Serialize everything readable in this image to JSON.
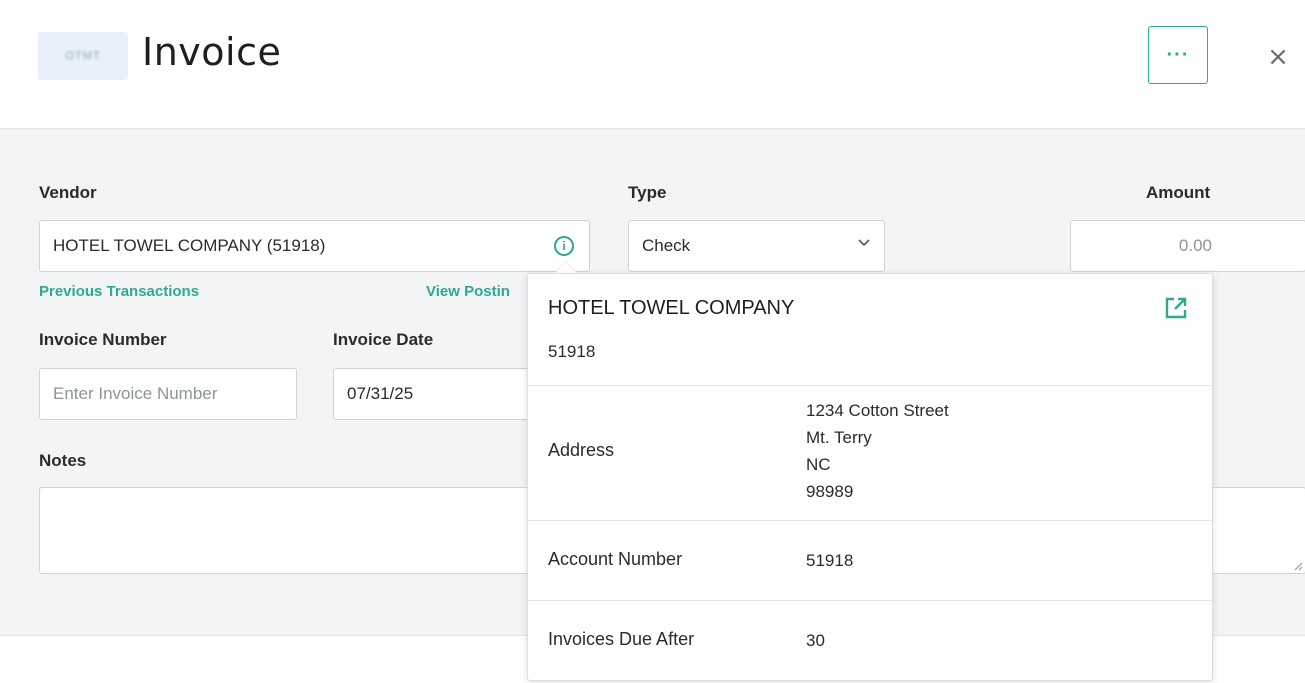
{
  "header": {
    "logo_text": "OTMT",
    "title": "Invoice",
    "more_label": "···",
    "close_label": "×"
  },
  "form": {
    "vendor": {
      "label": "Vendor",
      "value": "HOTEL TOWEL COMPANY (51918)",
      "previous_transactions": "Previous Transactions",
      "view_postings": "View Postin"
    },
    "type": {
      "label": "Type",
      "value": "Check"
    },
    "amount": {
      "label": "Amount",
      "placeholder": "0.00"
    },
    "invoice_number": {
      "label": "Invoice Number",
      "placeholder": "Enter Invoice Number"
    },
    "invoice_date": {
      "label": "Invoice Date",
      "value": "07/31/25"
    },
    "notes": {
      "label": "Notes",
      "value": ""
    }
  },
  "vendor_popover": {
    "name": "HOTEL TOWEL COMPANY",
    "id": "51918",
    "rows": [
      {
        "key": "Address",
        "value_lines": [
          "1234 Cotton Street",
          "Mt. Terry",
          "NC",
          "98989"
        ]
      },
      {
        "key": "Account Number",
        "value": "51918"
      },
      {
        "key": "Invoices Due After",
        "value": "30"
      }
    ]
  },
  "colors": {
    "accent": "#2fa98f",
    "form_background": "#f3f4f6",
    "border": "#cfd4d8"
  }
}
